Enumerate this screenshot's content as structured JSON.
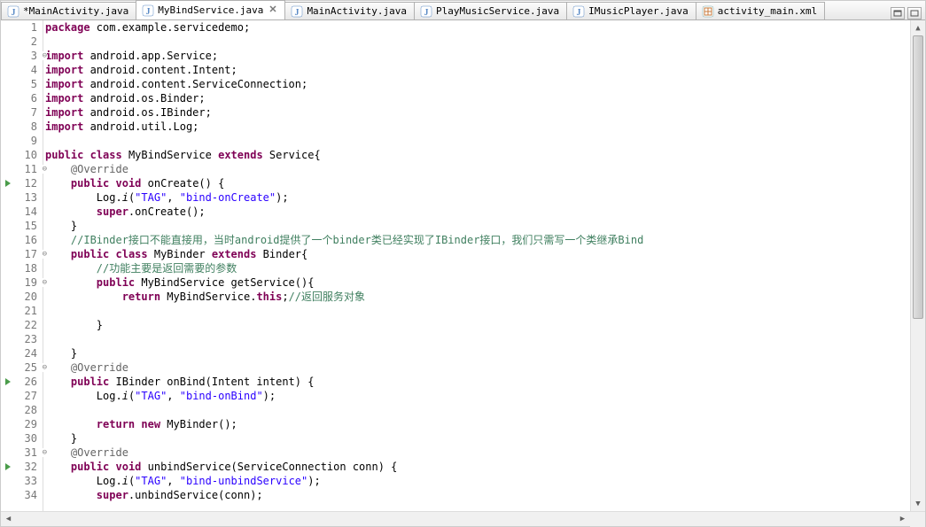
{
  "tabs": [
    {
      "label": "*MainActivity.java",
      "icon": "java",
      "active": false
    },
    {
      "label": "MyBindService.java",
      "icon": "java",
      "active": true
    },
    {
      "label": "MainActivity.java",
      "icon": "java",
      "active": false
    },
    {
      "label": "PlayMusicService.java",
      "icon": "java",
      "active": false
    },
    {
      "label": "IMusicPlayer.java",
      "icon": "java",
      "active": false
    },
    {
      "label": "activity_main.xml",
      "icon": "xml",
      "active": false
    }
  ],
  "lines": [
    {
      "n": 1,
      "marker": "",
      "fold": "",
      "html": "<span class='kw'>package</span> com.example.servicedemo;"
    },
    {
      "n": 2,
      "marker": "",
      "fold": "",
      "html": ""
    },
    {
      "n": 3,
      "marker": "",
      "fold": "⊖",
      "html": "<span class='kw'>import</span> android.app.Service;"
    },
    {
      "n": 4,
      "marker": "",
      "fold": "",
      "html": "<span class='kw'>import</span> android.content.Intent;"
    },
    {
      "n": 5,
      "marker": "",
      "fold": "",
      "html": "<span class='kw'>import</span> android.content.ServiceConnection;"
    },
    {
      "n": 6,
      "marker": "",
      "fold": "",
      "html": "<span class='kw'>import</span> android.os.Binder;"
    },
    {
      "n": 7,
      "marker": "",
      "fold": "",
      "html": "<span class='kw'>import</span> android.os.IBinder;"
    },
    {
      "n": 8,
      "marker": "",
      "fold": "",
      "html": "<span class='kw'>import</span> android.util.Log;"
    },
    {
      "n": 9,
      "marker": "",
      "fold": "",
      "html": ""
    },
    {
      "n": 10,
      "marker": "",
      "fold": "",
      "html": "<span class='kw'>public</span> <span class='kw'>class</span> MyBindService <span class='kw'>extends</span> Service{"
    },
    {
      "n": 11,
      "marker": "",
      "fold": "⊖",
      "html": "    <span class='ann'>@Override</span>"
    },
    {
      "n": 12,
      "marker": "tri",
      "fold": "",
      "html": "    <span class='kw'>public</span> <span class='kw'>void</span> onCreate() {"
    },
    {
      "n": 13,
      "marker": "",
      "fold": "",
      "html": "        Log.<i>i</i>(<span class='str'>\"TAG\"</span>, <span class='str'>\"bind-onCreate\"</span>);"
    },
    {
      "n": 14,
      "marker": "",
      "fold": "",
      "html": "        <span class='kw'>super</span>.onCreate();"
    },
    {
      "n": 15,
      "marker": "",
      "fold": "",
      "html": "    }"
    },
    {
      "n": 16,
      "marker": "",
      "fold": "",
      "html": "    <span class='cmt'>//IBinder接口不能直接用，当时android提供了一个binder类已经实现了IBinder接口，我们只需写一个类继承Bind</span>"
    },
    {
      "n": 17,
      "marker": "",
      "fold": "⊖",
      "html": "    <span class='kw'>public</span> <span class='kw'>class</span> MyBinder <span class='kw'>extends</span> Binder{"
    },
    {
      "n": 18,
      "marker": "",
      "fold": "",
      "html": "        <span class='cmt'>//功能主要是返回需要的参数</span>"
    },
    {
      "n": 19,
      "marker": "",
      "fold": "⊖",
      "html": "        <span class='kw'>public</span> MyBindService getService(){"
    },
    {
      "n": 20,
      "marker": "",
      "fold": "",
      "html": "            <span class='kw'>return</span> MyBindService.<span class='kw'>this</span>;<span class='cmt'>//返回服务对象</span>"
    },
    {
      "n": 21,
      "marker": "",
      "fold": "",
      "html": "            "
    },
    {
      "n": 22,
      "marker": "",
      "fold": "",
      "html": "        }"
    },
    {
      "n": 23,
      "marker": "",
      "fold": "",
      "html": "        "
    },
    {
      "n": 24,
      "marker": "",
      "fold": "",
      "html": "    }"
    },
    {
      "n": 25,
      "marker": "",
      "fold": "⊖",
      "html": "    <span class='ann'>@Override</span>"
    },
    {
      "n": 26,
      "marker": "tri",
      "fold": "",
      "html": "    <span class='kw'>public</span> IBinder onBind(Intent intent) {"
    },
    {
      "n": 27,
      "marker": "",
      "fold": "",
      "html": "        Log.<i>i</i>(<span class='str'>\"TAG\"</span>, <span class='str'>\"bind-onBind\"</span>);"
    },
    {
      "n": 28,
      "marker": "",
      "fold": "",
      "html": "        "
    },
    {
      "n": 29,
      "marker": "",
      "fold": "",
      "html": "        <span class='kw'>return</span> <span class='kw'>new</span> MyBinder();"
    },
    {
      "n": 30,
      "marker": "",
      "fold": "",
      "html": "    }"
    },
    {
      "n": 31,
      "marker": "",
      "fold": "⊖",
      "html": "    <span class='ann'>@Override</span>"
    },
    {
      "n": 32,
      "marker": "tri",
      "fold": "",
      "html": "    <span class='kw'>public</span> <span class='kw'>void</span> unbindService(ServiceConnection conn) {"
    },
    {
      "n": 33,
      "marker": "",
      "fold": "",
      "html": "        Log.<i>i</i>(<span class='str'>\"TAG\"</span>, <span class='str'>\"bind-unbindService\"</span>);"
    },
    {
      "n": 34,
      "marker": "",
      "fold": "",
      "html": "        <span class='kw'>super</span>.unbindService(conn);"
    }
  ]
}
